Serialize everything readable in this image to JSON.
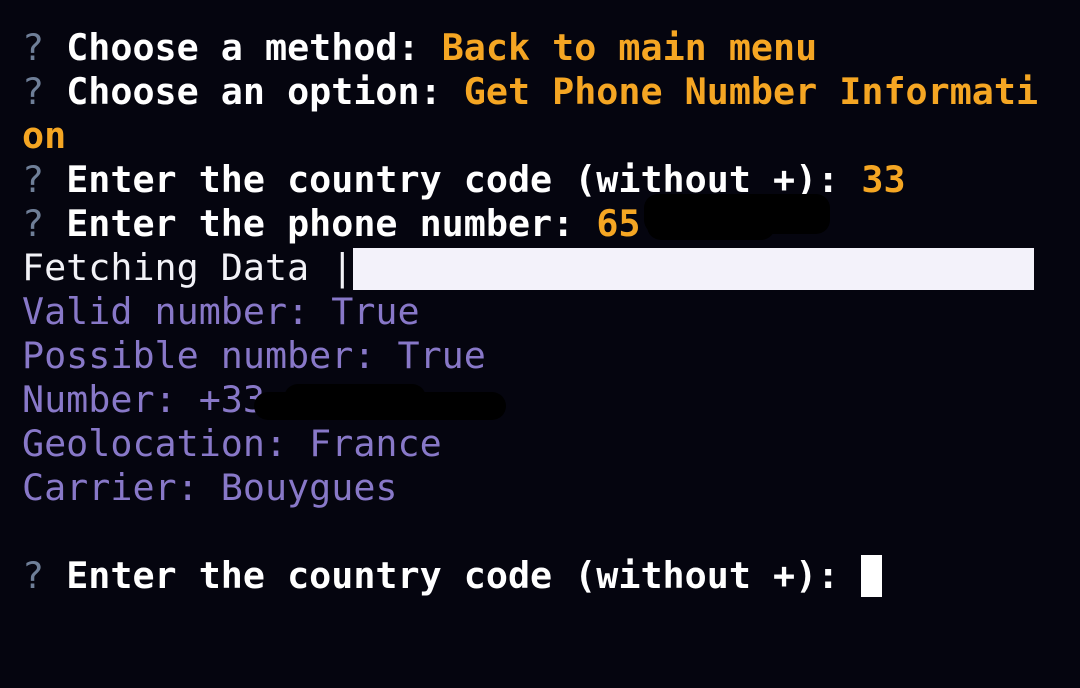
{
  "prompt_symbol": "?",
  "lines": {
    "method": {
      "prompt": "Choose a method:",
      "answer": "Back to main menu"
    },
    "option": {
      "prompt": "Choose an option:",
      "answer_line1": "Get Phone Number Informati",
      "answer_line2": "on"
    },
    "country_code": {
      "prompt": "Enter the country code (without +):",
      "answer": "33"
    },
    "phone": {
      "prompt": "Enter the phone number:",
      "answer_visible": "65"
    }
  },
  "progress": {
    "label": "Fetching Data |",
    "fraction": 1.0
  },
  "results": {
    "valid": "Valid number: True",
    "possible": "Possible number: True",
    "number": "Number: +33",
    "geolocation": "Geolocation: France",
    "carrier": "Carrier: Bouygues"
  },
  "current_prompt": {
    "prompt": "Enter the country code (without +):"
  },
  "colors": {
    "background": "#05050f",
    "answer": "#f5a623",
    "info": "#8878c8",
    "question_mark": "#6f7f98"
  }
}
